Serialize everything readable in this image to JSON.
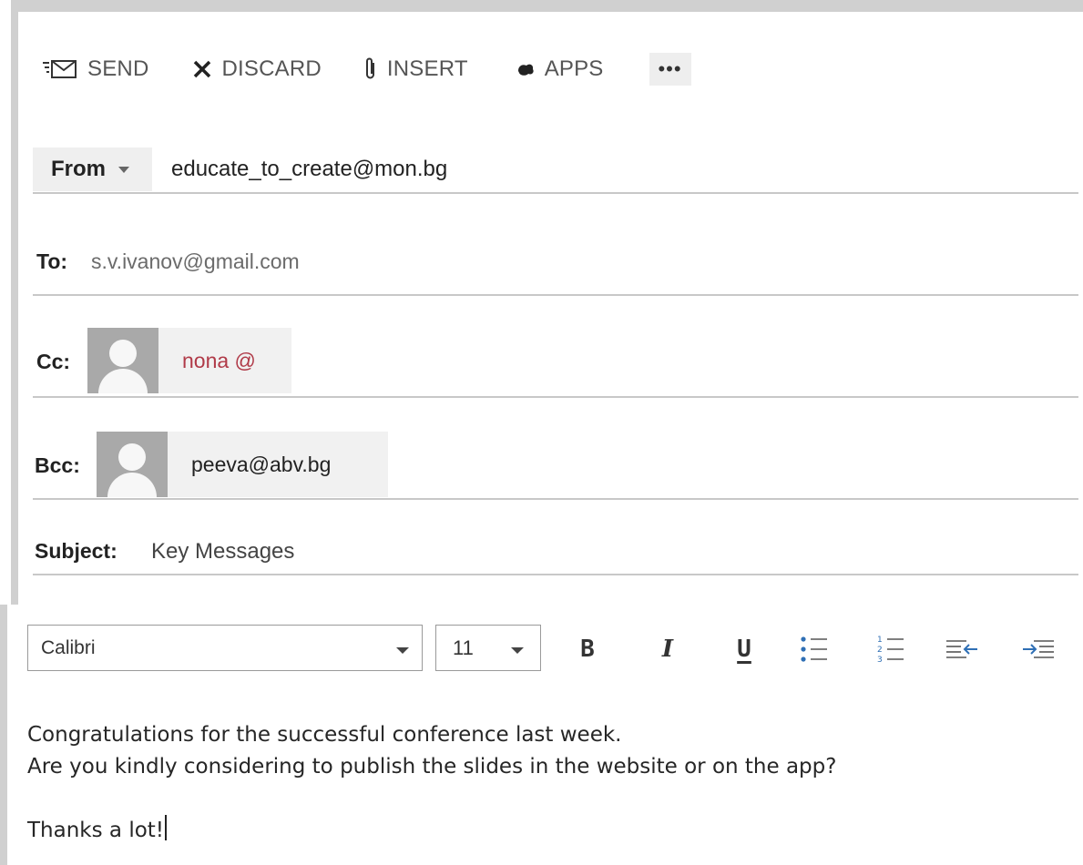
{
  "toolbar": {
    "send_label": "SEND",
    "discard_label": "DISCARD",
    "insert_label": "INSERT",
    "apps_label": "APPS",
    "more_label": "•••"
  },
  "from": {
    "label": "From",
    "address": "educate_to_create@mon.bg"
  },
  "to": {
    "label": "To:",
    "value": "s.v.ivanov@gmail.com"
  },
  "cc": {
    "label": "Cc:",
    "recipient": "nona @"
  },
  "bcc": {
    "label": "Bcc:",
    "recipient": "peeva@abv.bg"
  },
  "subject": {
    "label": "Subject:",
    "value": "Key Messages"
  },
  "format": {
    "font": "Calibri",
    "size": "11",
    "bold": "B",
    "italic": "I",
    "underline": "U"
  },
  "body": {
    "lines": [
      "Congratulations for the successful conference last week.",
      "Are you kindly considering to publish the slides in the website or on the app?",
      "",
      "Thanks a lot!"
    ]
  }
}
